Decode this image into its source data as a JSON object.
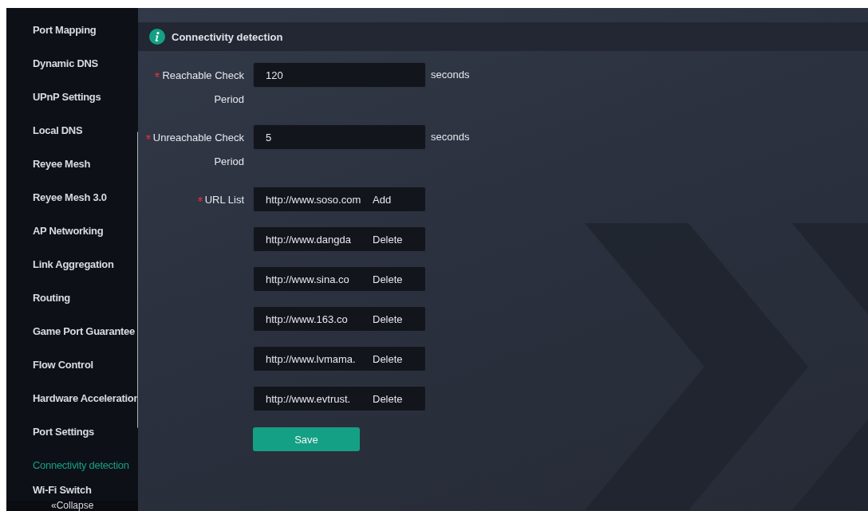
{
  "sidebar": {
    "items": [
      {
        "label": "Port Mapping",
        "selected": false
      },
      {
        "label": "Dynamic DNS",
        "selected": false
      },
      {
        "label": "UPnP Settings",
        "selected": false
      },
      {
        "label": "Local DNS",
        "selected": false
      },
      {
        "label": "Reyee Mesh",
        "selected": false
      },
      {
        "label": "Reyee Mesh 3.0",
        "selected": false
      },
      {
        "label": "AP Networking",
        "selected": false
      },
      {
        "label": "Link Aggregation",
        "selected": false
      },
      {
        "label": "Routing",
        "selected": false
      },
      {
        "label": "Game Port Guarantee",
        "selected": false
      },
      {
        "label": "Flow Control",
        "selected": false
      },
      {
        "label": "Hardware Acceleration",
        "selected": false
      },
      {
        "label": "Port Settings",
        "selected": false
      },
      {
        "label": "Connectivity detection",
        "selected": true
      },
      {
        "label": "Wi-Fi Switch",
        "selected": false
      }
    ],
    "collapse": "«Collapse"
  },
  "header": {
    "title": "Connectivity detection"
  },
  "fields": [
    {
      "required": true,
      "label": "Reachable Check Period",
      "value": "120",
      "unit": "seconds"
    },
    {
      "required": true,
      "label": "Unreachable Check Period",
      "value": "5",
      "unit": "seconds"
    }
  ],
  "url_list": {
    "required": true,
    "label": "URL List",
    "entries": [
      {
        "value": "http://www.soso.com",
        "action": "Add"
      },
      {
        "value": "http://www.dangda",
        "action": "Delete"
      },
      {
        "value": "http://www.sina.co",
        "action": "Delete"
      },
      {
        "value": "http://www.163.co",
        "action": "Delete"
      },
      {
        "value": "http://www.lvmama.",
        "action": "Delete"
      },
      {
        "value": "http://www.evtrust.",
        "action": "Delete"
      }
    ]
  },
  "save_button": "Save"
}
